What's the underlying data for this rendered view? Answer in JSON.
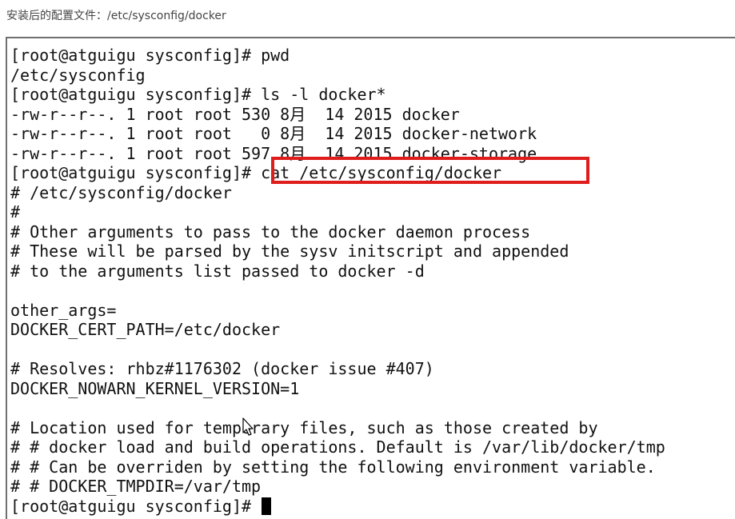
{
  "caption": "安装后的配置文件：/etc/sysconfig/docker",
  "terminal": {
    "lines": [
      "[root@atguigu sysconfig]# pwd",
      "/etc/sysconfig",
      "[root@atguigu sysconfig]# ls -l docker*",
      "-rw-r--r--. 1 root root 530 8月  14 2015 docker",
      "-rw-r--r--. 1 root root   0 8月  14 2015 docker-network",
      "-rw-r--r--. 1 root root 597 8月  14 2015 docker-storage",
      "[root@atguigu sysconfig]# cat /etc/sysconfig/docker",
      "# /etc/sysconfig/docker",
      "#",
      "# Other arguments to pass to the docker daemon process",
      "# These will be parsed by the sysv initscript and appended",
      "# to the arguments list passed to docker -d",
      "",
      "other_args=",
      "DOCKER_CERT_PATH=/etc/docker",
      "",
      "# Resolves: rhbz#1176302 (docker issue #407)",
      "DOCKER_NOWARN_KERNEL_VERSION=1",
      "",
      "# Location used for temporary files, such as those created by",
      "# # docker load and build operations. Default is /var/lib/docker/tmp",
      "# # Can be overriden by setting the following environment variable.",
      "# # DOCKER_TMPDIR=/var/tmp"
    ],
    "prompt": "[root@atguigu sysconfig]# "
  },
  "colors": {
    "highlight": "#e01d1d",
    "text": "#111111",
    "background": "#ffffff"
  }
}
